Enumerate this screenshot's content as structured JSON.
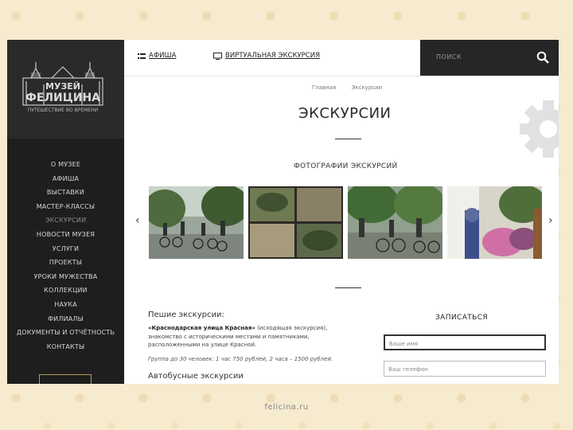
{
  "logo": {
    "top_text": "МУЗЕЙ",
    "bottom_text": "ФЕЛИЦИНА",
    "tagline": "ПУТЕШЕСТВИЕ ВО ВРЕМЕНИ"
  },
  "sidebar": {
    "items": [
      {
        "label": "О МУЗЕЕ"
      },
      {
        "label": "АФИША"
      },
      {
        "label": "ВЫСТАВКИ"
      },
      {
        "label": "МАСТЕР-КЛАССЫ"
      },
      {
        "label": "ЭКСКУРСИИ"
      },
      {
        "label": "НОВОСТИ МУЗЕЯ"
      },
      {
        "label": "УСЛУГИ"
      },
      {
        "label": "ПРОЕКТЫ"
      },
      {
        "label": "УРОКИ МУЖЕСТВА"
      },
      {
        "label": "КОЛЛЕКЦИИ"
      },
      {
        "label": "НАУКА"
      },
      {
        "label": "ФИЛИАЛЫ"
      },
      {
        "label": "ДОКУМЕНТЫ И ОТЧЁТНОСТЬ"
      },
      {
        "label": "КОНТАКТЫ"
      }
    ],
    "active_index": 4
  },
  "topbar": {
    "afisha": "АФИША",
    "virtual_tour": "ВИРТУАЛЬНАЯ ЭКСКУРСИЯ",
    "search_placeholder": "ПОИСК"
  },
  "breadcrumb": {
    "home": "Главная",
    "current": "Экскурсии"
  },
  "page": {
    "title": "ЭКСКУРСИИ",
    "photos_title": "ФОТОГРАФИИ ЭКСКУРСИЙ"
  },
  "carousel": {
    "prev": "‹",
    "next": "›"
  },
  "tours": {
    "walking_title": "Пешие экскурсии:",
    "walking_name": "«Краснодарская улица Красная»",
    "walking_desc": " (исходящая экскурсия), знакомство с историческими местами и памятниками, расположенными на улице Красной.",
    "walking_note": "Группа до 30 человек: 1 час 750 рублей, 2 часа – 1500 рублей.",
    "bus_title": "Автобусные экскурсии"
  },
  "form": {
    "title": "ЗАПИСАТЬСЯ",
    "name_placeholder": "Ваше имя",
    "phone_placeholder": "Ваш телефон"
  },
  "footer": {
    "url": "felicina.ru"
  }
}
